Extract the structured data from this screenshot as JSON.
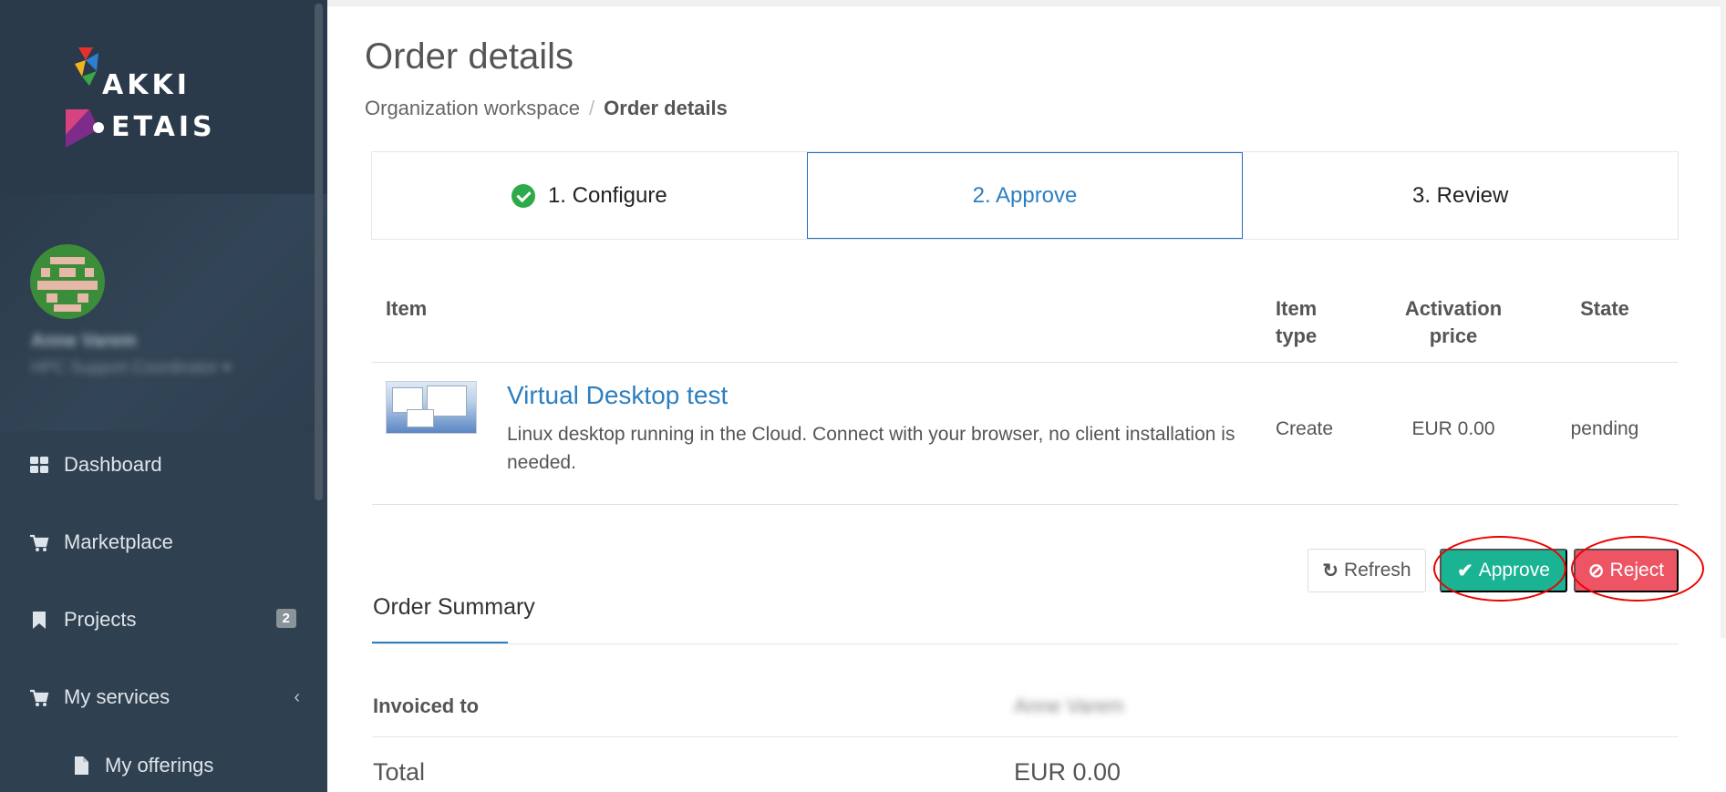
{
  "logo": {
    "line1": "AKKI",
    "line2": "ETAIS"
  },
  "profile": {
    "name": "Anne Varem",
    "role": "HPC Support Coordinator ▾"
  },
  "sidebar": {
    "items": [
      {
        "label": "Dashboard",
        "icon": "dashboard-icon"
      },
      {
        "label": "Marketplace",
        "icon": "cart-icon"
      },
      {
        "label": "Projects",
        "icon": "bookmark-icon",
        "badge": "2"
      },
      {
        "label": "My services",
        "icon": "cart-icon",
        "chevron": "‹"
      },
      {
        "label": "My offerings",
        "icon": "file-icon"
      }
    ]
  },
  "page": {
    "title": "Order details",
    "breadcrumb": {
      "parent": "Organization workspace",
      "separator": "/",
      "current": "Order details"
    }
  },
  "steps": [
    {
      "label": "1. Configure",
      "state": "done"
    },
    {
      "label": "2. Approve",
      "state": "active"
    },
    {
      "label": "3. Review",
      "state": "pending"
    }
  ],
  "items_table": {
    "headers": {
      "item": "Item",
      "item_type": "Item type",
      "activation_price": "Activation price",
      "state": "State"
    },
    "rows": [
      {
        "title": "Virtual Desktop test",
        "description": "Linux desktop running in the Cloud. Connect with your browser, no client installation is needed.",
        "item_type": "Create",
        "activation_price": "EUR 0.00",
        "state": "pending"
      }
    ]
  },
  "actions": {
    "refresh": "Refresh",
    "approve": "Approve",
    "reject": "Reject"
  },
  "summary": {
    "tab": "Order Summary",
    "invoiced_to_label": "Invoiced to",
    "invoiced_to_value": "Anne Varem",
    "total_label": "Total",
    "total_value": "EUR 0.00"
  },
  "colors": {
    "sidebar": "#2f4050",
    "accent": "#2d7fc1",
    "approve": "#1ab394",
    "reject": "#ed5565",
    "done": "#2eaa4a"
  }
}
